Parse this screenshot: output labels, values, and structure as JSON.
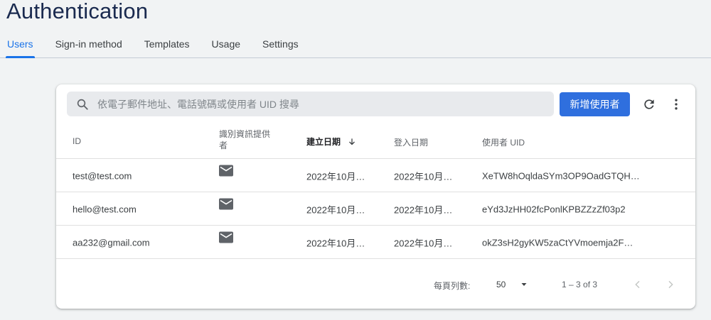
{
  "header": {
    "title": "Authentication",
    "tabs": [
      "Users",
      "Sign-in method",
      "Templates",
      "Usage",
      "Settings"
    ]
  },
  "toolbar": {
    "search_placeholder": "依電子郵件地址、電話號碼或使用者 UID 搜尋",
    "add_user_label": "新增使用者",
    "refresh_icon": "refresh-icon",
    "more_icon": "more-vert-icon"
  },
  "table": {
    "columns": {
      "id": "ID",
      "provider": "識別資訊提供者",
      "created": "建立日期",
      "signed_in": "登入日期",
      "uid": "使用者 UID"
    },
    "rows": [
      {
        "id": "test@test.com",
        "provider_icon": "mail-icon",
        "created": "2022年10月…",
        "signed_in": "2022年10月…",
        "uid": "XeTW8hOqldaSYm3OP9OadGTQH…"
      },
      {
        "id": "hello@test.com",
        "provider_icon": "mail-icon",
        "created": "2022年10月…",
        "signed_in": "2022年10月…",
        "uid": "eYd3JzHH02fcPonlKPBZZzZf03p2"
      },
      {
        "id": "aa232@gmail.com",
        "provider_icon": "mail-icon",
        "created": "2022年10月…",
        "signed_in": "2022年10月…",
        "uid": "okZ3sH2gyKW5zaCtYVmoemja2F…"
      }
    ]
  },
  "pagination": {
    "rows_per_page_label": "每頁列數:",
    "rows_per_page_value": "50",
    "range_text": "1 – 3 of 3"
  },
  "colors": {
    "accent": "#1a73e8",
    "button": "#2f6fde",
    "title": "#1a2a4f"
  }
}
